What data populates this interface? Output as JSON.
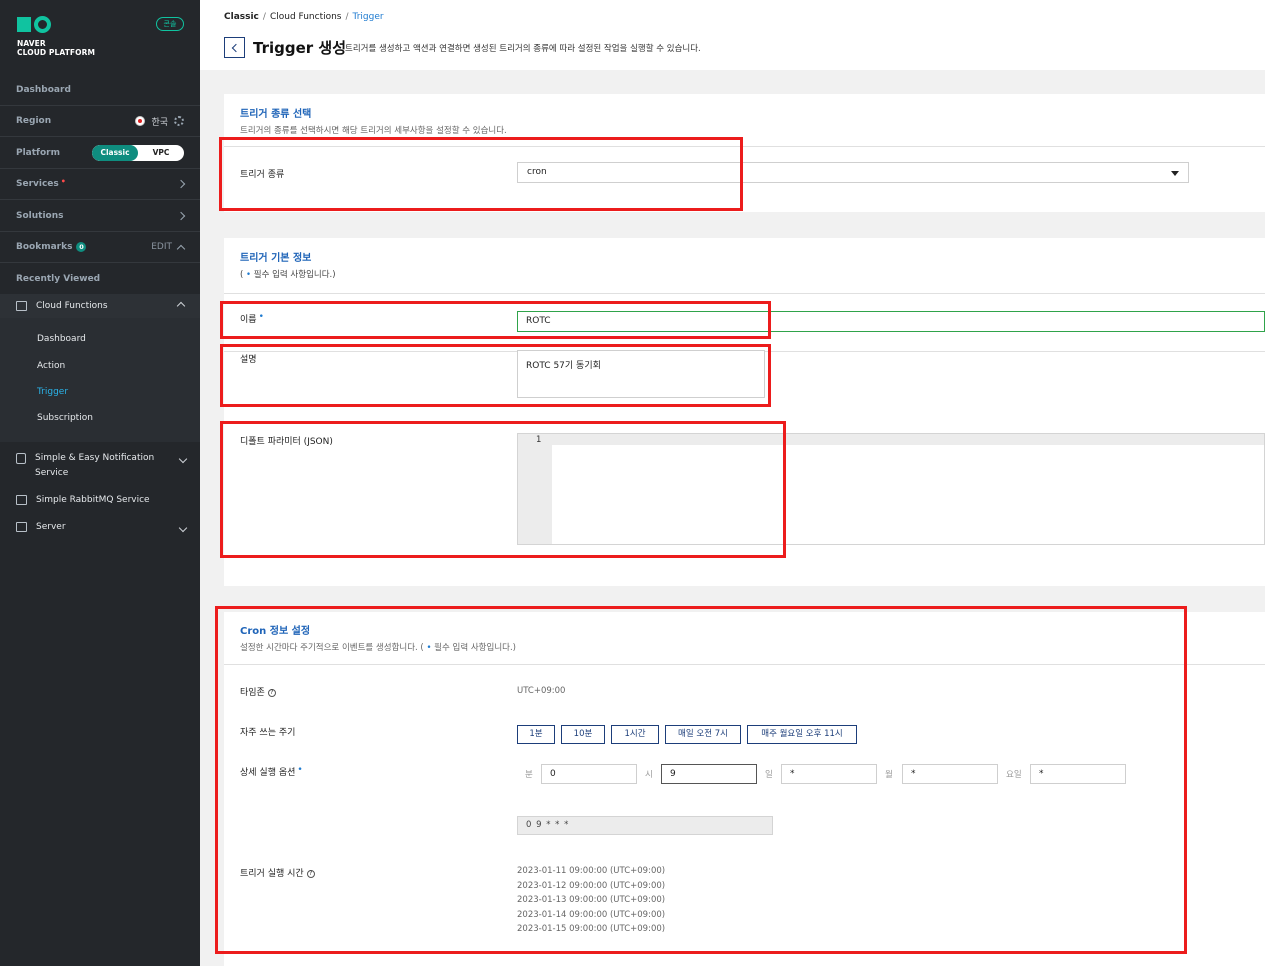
{
  "sidebar": {
    "logo_line1": "NAVER",
    "logo_line2": "CLOUD PLATFORM",
    "console_badge": "콘솔",
    "dashboard": "Dashboard",
    "region_label": "Region",
    "region_value": "한국",
    "platform_label": "Platform",
    "platform_options": [
      "Classic",
      "VPC"
    ],
    "platform_selected": "Classic",
    "services": "Services",
    "solutions": "Solutions",
    "bookmarks": "Bookmarks",
    "bookmarks_count": "0",
    "bookmarks_edit": "EDIT",
    "recently_viewed": "Recently Viewed",
    "cloud_functions": "Cloud Functions",
    "cf_items": [
      "Dashboard",
      "Action",
      "Trigger",
      "Subscription"
    ],
    "cf_active": "Trigger",
    "sens_line1": "Simple & Easy Notification",
    "sens_line2": "Service",
    "rabbitmq": "Simple RabbitMQ Service",
    "server": "Server"
  },
  "header": {
    "breadcrumb": [
      "Classic",
      "Cloud Functions",
      "Trigger"
    ],
    "title": "Trigger 생성",
    "description": "트리거를 생성하고 액션과 연결하면 생성된 트리거의 종류에 따라 설정된 작업을 실행할 수 있습니다."
  },
  "trigger_type": {
    "title": "트리거 종류 선택",
    "description": "트리거의 종류를 선택하시면 해당 트리거의 세부사항을 설정할 수 있습니다.",
    "label": "트리거 종류",
    "value": "cron"
  },
  "basic_info": {
    "title": "트리거 기본 정보",
    "note_prefix": "(",
    "note_text": "필수 입력 사항입니다.)",
    "name_label": "이름",
    "name_value": "ROTC",
    "desc_label": "설명",
    "desc_value": "ROTC 57기 동기회",
    "param_label": "디폴트 파라미터 (JSON)",
    "line_number": "1"
  },
  "cron": {
    "title": "Cron 정보 설정",
    "description": "설정한 시간마다 주기적으로 이벤트를 생성합니다. (",
    "description_tail": "필수 입력 사항입니다.)",
    "timezone_label": "타임존",
    "timezone_value": "UTC+09:00",
    "frequent_label": "자주 쓰는 주기",
    "frequent_buttons": [
      "1분",
      "10분",
      "1시간",
      "매일 오전 7시",
      "매주 월요일 오후 11시"
    ],
    "detail_label": "상세 실행 옵션",
    "fields": [
      {
        "unit": "분",
        "value": "0"
      },
      {
        "unit": "시",
        "value": "9"
      },
      {
        "unit": "일",
        "value": "*"
      },
      {
        "unit": "월",
        "value": "*"
      },
      {
        "unit": "요일",
        "value": "*"
      }
    ],
    "expression": "0 9 * * *",
    "run_times_label": "트리거 실행 시간",
    "run_times": [
      "2023-01-11 09:00:00 (UTC+09:00)",
      "2023-01-12 09:00:00 (UTC+09:00)",
      "2023-01-13 09:00:00 (UTC+09:00)",
      "2023-01-14 09:00:00 (UTC+09:00)",
      "2023-01-15 09:00:00 (UTC+09:00)"
    ]
  },
  "colors": {
    "accent": "#0f8d7f",
    "link": "#1f7bd0",
    "highlight": "#ec1c1c"
  }
}
